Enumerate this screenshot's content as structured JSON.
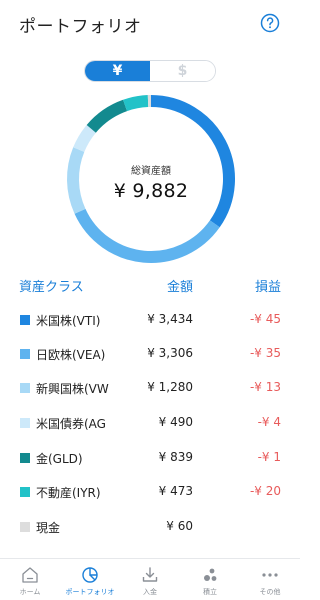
{
  "header": {
    "title": "ポートフォリオ"
  },
  "currency_toggle": {
    "yen_label": "¥",
    "usd_label": "$",
    "selected": "yen"
  },
  "summary": {
    "label": "総資産額",
    "total": "¥ 9,882",
    "total_value": 9882
  },
  "table": {
    "headers": {
      "asset_class": "資産クラス",
      "amount": "金額",
      "profit_loss": "損益"
    },
    "rows": [
      {
        "name": "米国株(VTI)",
        "amount": "¥ 3,434",
        "profit_loss": "-¥ 45",
        "color": "#1f86e0",
        "value": 3434
      },
      {
        "name": "日欧株(VEA)",
        "amount": "¥ 3,306",
        "profit_loss": "-¥ 35",
        "color": "#5eb3ef",
        "value": 3306
      },
      {
        "name": "新興国株(VW",
        "amount": "¥ 1,280",
        "profit_loss": "-¥ 13",
        "color": "#a8d9f6",
        "value": 1280
      },
      {
        "name": "米国債券(AG",
        "amount": "¥ 490",
        "profit_loss": "-¥ 4",
        "color": "#cde9fa",
        "value": 490
      },
      {
        "name": "金(GLD)",
        "amount": "¥ 839",
        "profit_loss": "-¥ 1",
        "color": "#138a8f",
        "value": 839
      },
      {
        "name": "不動産(IYR)",
        "amount": "¥ 473",
        "profit_loss": "-¥ 20",
        "color": "#22c2c8",
        "value": 473
      },
      {
        "name": "現金",
        "amount": "¥ 60",
        "profit_loss": "",
        "color": "#dddddd",
        "value": 60
      }
    ]
  },
  "tabbar": {
    "tabs": [
      {
        "label": "ホーム",
        "icon": "home-icon",
        "active": false
      },
      {
        "label": "ポートフォリオ",
        "icon": "pie-chart-icon",
        "active": true
      },
      {
        "label": "入金",
        "icon": "deposit-icon",
        "active": false
      },
      {
        "label": "積立",
        "icon": "dots-cluster-icon",
        "active": false
      },
      {
        "label": "その他",
        "icon": "more-icon",
        "active": false
      }
    ]
  },
  "colors": {
    "accent": "#1a7fd8",
    "negative": "#e85b5b"
  }
}
